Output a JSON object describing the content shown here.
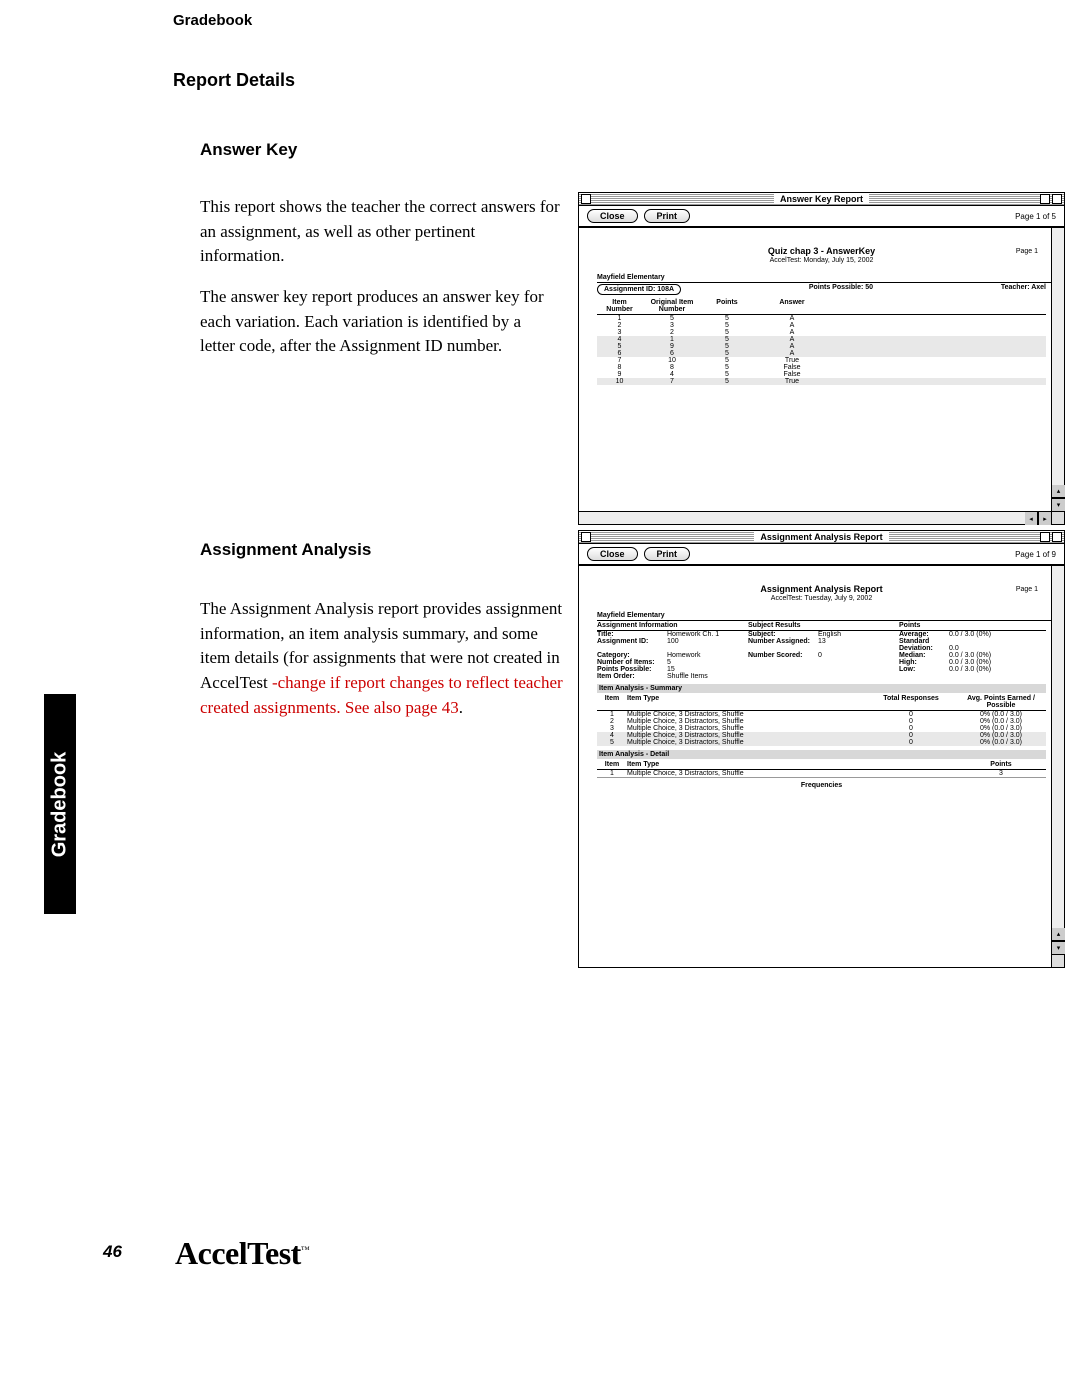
{
  "header": "Gradebook",
  "section_title": "Report Details",
  "sidebar_tab": "Gradebook",
  "page_number": "46",
  "brand": "AccelTest",
  "tm": "™",
  "sub1": "Answer Key",
  "para1": "This report shows the teacher the correct answers for an assignment, as well as other pertinent information.",
  "para2": "The answer key report produces an answer key for each variation. Each variation is identified by a letter code, after the Assignment ID number.",
  "sub2": "Assignment Analysis",
  "para3_black": "The Assignment Analysis report provides assignment information, an item analysis summary, and some item details (for assignments that were not created in AccelTest ",
  "para3_red": "-change if report changes to reflect teacher created assignments. See also  page 43",
  "para3_end": ".",
  "win1": {
    "title": "Answer Key Report",
    "close": "Close",
    "print": "Print",
    "page": "Page 1 of 5",
    "rpt_title": "Quiz chap 3 - AnswerKey",
    "rpt_sub": "AccelTest: Monday, July 15, 2002",
    "rpt_page": "Page 1",
    "school": "Mayfield Elementary",
    "assign_id": "Assignment ID: 108A",
    "points_poss": "Points Possible: 50",
    "teacher": "Teacher: Axel",
    "head": {
      "c1": "Item Number",
      "c2": "Original Item Number",
      "c3": "Points",
      "c4": "Answer"
    },
    "rows": [
      {
        "n": "1",
        "o": "5",
        "p": "5",
        "a": "A"
      },
      {
        "n": "2",
        "o": "3",
        "p": "5",
        "a": "A"
      },
      {
        "n": "3",
        "o": "2",
        "p": "5",
        "a": "A"
      },
      {
        "n": "4",
        "o": "1",
        "p": "5",
        "a": "A"
      },
      {
        "n": "5",
        "o": "9",
        "p": "5",
        "a": "A"
      },
      {
        "n": "6",
        "o": "6",
        "p": "5",
        "a": "A"
      },
      {
        "n": "7",
        "o": "10",
        "p": "5",
        "a": "True"
      },
      {
        "n": "8",
        "o": "8",
        "p": "5",
        "a": "False"
      },
      {
        "n": "9",
        "o": "4",
        "p": "5",
        "a": "False"
      },
      {
        "n": "10",
        "o": "7",
        "p": "5",
        "a": "True"
      }
    ]
  },
  "win2": {
    "title": "Assignment Analysis Report",
    "close": "Close",
    "print": "Print",
    "page": "Page 1 of 9",
    "rpt_title": "Assignment Analysis Report",
    "rpt_sub": "AccelTest: Tuesday, July 9, 2002",
    "rpt_page": "Page 1",
    "school": "Mayfield Elementary",
    "sec_info": "Assignment Information",
    "sec_subj": "Subject Results",
    "sec_pts": "Points",
    "info": {
      "title_l": "Title:",
      "title_v": "Homework Ch. 1",
      "subj_l": "Subject:",
      "subj_v": "English",
      "avg_l": "Average:",
      "avg_v": "0.0 / 3.0 (0%)",
      "id_l": "Assignment ID:",
      "id_v": "100",
      "na_l": "Number Assigned:",
      "na_v": "13",
      "sd_l": "Standard Deviation:",
      "sd_v": "0.0",
      "cat_l": "Category:",
      "cat_v": "Homework",
      "ns_l": "Number Scored:",
      "ns_v": "0",
      "med_l": "Median:",
      "med_v": "0.0 / 3.0 (0%)",
      "ni_l": "Number of Items:",
      "ni_v": "5",
      "hi_l": "High:",
      "hi_v": "0.0 / 3.0 (0%)",
      "pp_l": "Points Possible:",
      "pp_v": "15",
      "lo_l": "Low:",
      "lo_v": "0.0 / 3.0 (0%)",
      "io_l": "Item Order:",
      "io_v": "Shuffle Items"
    },
    "sec_summary": "Item Analysis - Summary",
    "sum_head": {
      "c1": "Item",
      "c2": "Item Type",
      "c3": "Total Responses",
      "c4": "Avg. Points Earned / Possible"
    },
    "sum_rows": [
      {
        "i": "1",
        "t": "Multiple Choice, 3 Distractors, Shuffle",
        "r": "0",
        "p": "0% (0.0 / 3.0)"
      },
      {
        "i": "2",
        "t": "Multiple Choice, 3 Distractors, Shuffle",
        "r": "0",
        "p": "0% (0.0 / 3.0)"
      },
      {
        "i": "3",
        "t": "Multiple Choice, 3 Distractors, Shuffle",
        "r": "0",
        "p": "0% (0.0 / 3.0)"
      },
      {
        "i": "4",
        "t": "Multiple Choice, 3 Distractors, Shuffle",
        "r": "0",
        "p": "0% (0.0 / 3.0)"
      },
      {
        "i": "5",
        "t": "Multiple Choice, 3 Distractors, Shuffle",
        "r": "0",
        "p": "0% (0.0 / 3.0)"
      }
    ],
    "sec_detail": "Item Analysis - Detail",
    "dtl_head": {
      "c1": "Item",
      "c2": "Item Type",
      "c3": "Points"
    },
    "dtl_row": {
      "i": "1",
      "t": "Multiple Choice, 3 Distractors, Shuffle",
      "p": "3"
    },
    "freq": "Frequencies"
  }
}
